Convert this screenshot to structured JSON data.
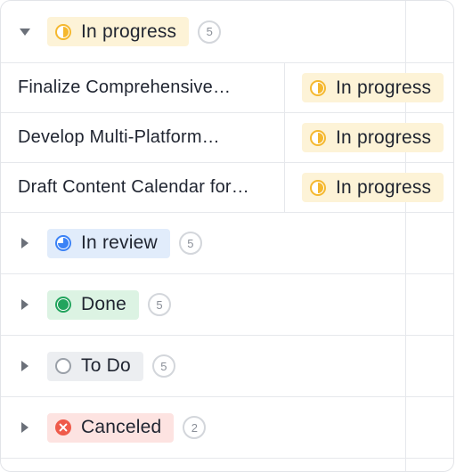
{
  "groups": [
    {
      "label": "In progress",
      "count": "5",
      "expanded": true,
      "icon": "half-circle-icon",
      "color": "#f5b82e",
      "tasks": [
        {
          "name": "Finalize Comprehensive…",
          "status": "In progress"
        },
        {
          "name": "Develop Multi-Platform…",
          "status": "In progress"
        },
        {
          "name": "Draft Content Calendar for…",
          "status": "In progress"
        }
      ]
    },
    {
      "label": "In review",
      "count": "5",
      "expanded": false,
      "icon": "pie-quarter-icon",
      "color": "#3b82f6"
    },
    {
      "label": "Done",
      "count": "5",
      "expanded": false,
      "icon": "filled-circle-icon",
      "color": "#22a45d"
    },
    {
      "label": "To Do",
      "count": "5",
      "expanded": false,
      "icon": "empty-circle-icon",
      "color": "#9aa0a8"
    },
    {
      "label": "Canceled",
      "count": "2",
      "expanded": false,
      "icon": "x-circle-icon",
      "color": "#ef5a4a"
    }
  ]
}
